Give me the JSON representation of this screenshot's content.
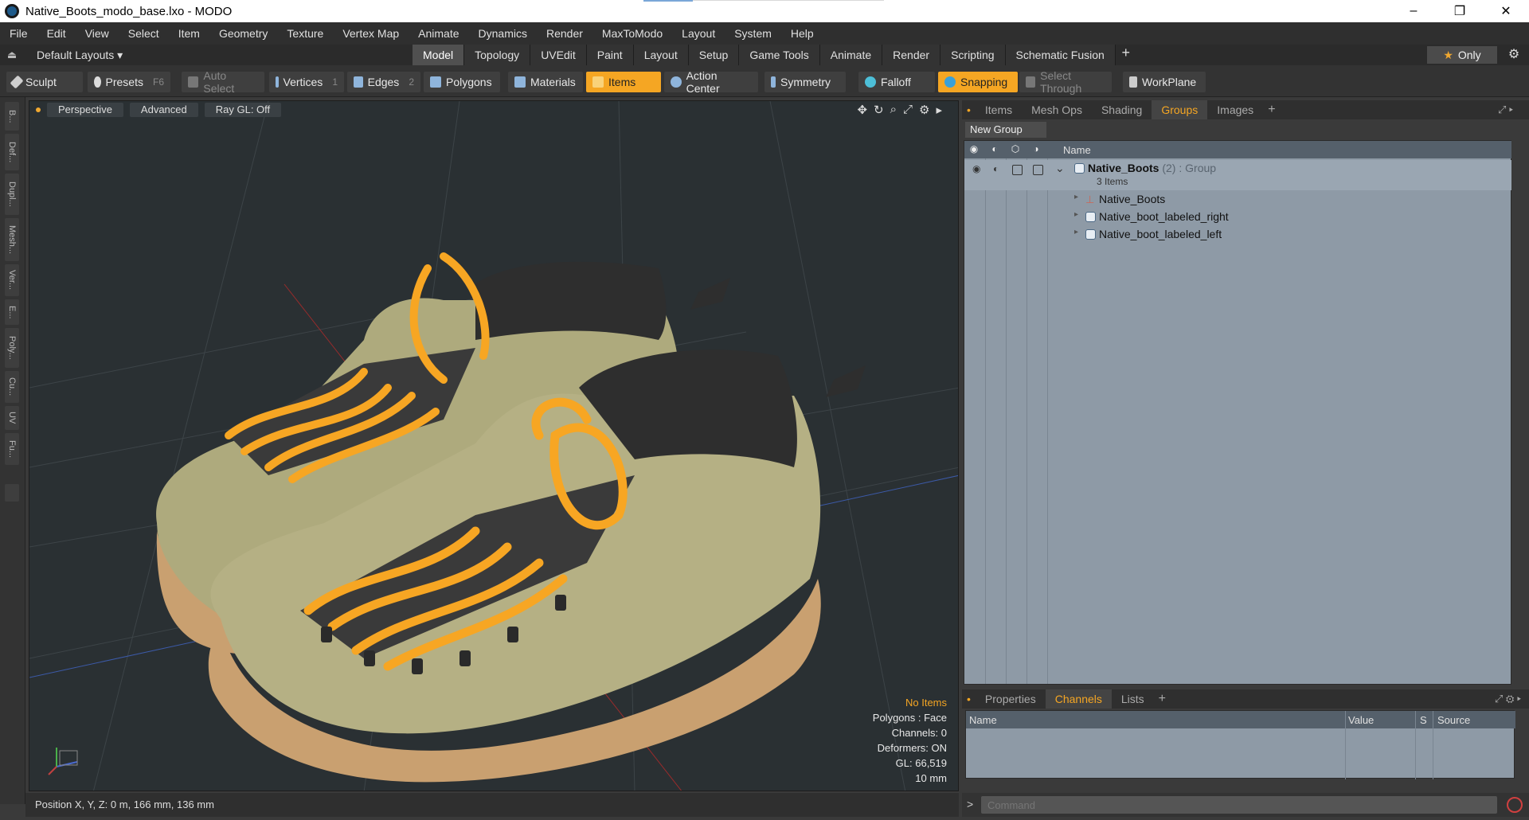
{
  "window": {
    "title": "Native_Boots_modo_base.lxo - MODO",
    "minimize": "–",
    "maximize": "❐",
    "close": "✕"
  },
  "menu": [
    "File",
    "Edit",
    "View",
    "Select",
    "Item",
    "Geometry",
    "Texture",
    "Vertex Map",
    "Animate",
    "Dynamics",
    "Render",
    "MaxToModo",
    "Layout",
    "System",
    "Help"
  ],
  "layout_bar": {
    "layouts": "Default Layouts ▾",
    "tabs": [
      "Model",
      "Topology",
      "UVEdit",
      "Paint",
      "Layout",
      "Setup",
      "Game Tools",
      "Animate",
      "Render",
      "Scripting",
      "Schematic Fusion"
    ],
    "active_tab": "Model",
    "add_tab": "+",
    "only": "Only",
    "star": "★",
    "gear": "⚙"
  },
  "toolbar": {
    "sculpt": "Sculpt",
    "presets": "Presets",
    "presets_key": "F6",
    "auto_select": "Auto Select",
    "vertices": "Vertices",
    "vertices_num": "1",
    "edges": "Edges",
    "edges_num": "2",
    "polygons": "Polygons",
    "materials": "Materials",
    "items": "Items",
    "action_center": "Action Center",
    "symmetry": "Symmetry",
    "falloff": "Falloff",
    "snapping": "Snapping",
    "select_through": "Select Through",
    "workplane": "WorkPlane"
  },
  "left_strip": [
    "B...",
    "Def...",
    "Dupl...",
    "Mesh...",
    "Ver...",
    "E...",
    "Poly...",
    "Cu...",
    "UV",
    "Fu..."
  ],
  "viewport": {
    "tabs": [
      "Perspective",
      "Advanced",
      "Ray GL: Off"
    ],
    "stats": {
      "no_items": "No Items",
      "polygons": "Polygons : Face",
      "channels": "Channels: 0",
      "deformers": "Deformers: ON",
      "gl": "GL: 66,519",
      "scale": "10 mm"
    }
  },
  "right_panel": {
    "tabs": [
      "Items",
      "Mesh Ops",
      "Shading",
      "Groups",
      "Images"
    ],
    "active_tab": "Groups",
    "add_tab": "+",
    "new_group": "New Group",
    "column_name": "Name",
    "group": {
      "name": "Native_Boots",
      "count": "(2)",
      "type": ": Group",
      "items_label": "3 Items"
    },
    "children": [
      {
        "name": "Native_Boots",
        "icon": "locator-icon"
      },
      {
        "name": "Native_boot_labeled_right",
        "icon": "mesh-icon"
      },
      {
        "name": "Native_boot_labeled_left",
        "icon": "mesh-icon"
      }
    ]
  },
  "channels_panel": {
    "tabs": [
      "Properties",
      "Channels",
      "Lists"
    ],
    "active_tab": "Channels",
    "add_tab": "+",
    "columns": {
      "name": "Name",
      "value": "Value",
      "s": "S",
      "source": "Source"
    }
  },
  "command": {
    "placeholder": "Command",
    "arrow": ">"
  },
  "status": {
    "position": "Position X, Y, Z:   0 m, 166 mm, 136 mm"
  },
  "colors": {
    "accent": "#f5a623",
    "boot_body": "#b5b084",
    "sole": "#c9a070",
    "lace": "#f7a623",
    "collar": "#2e2e2e"
  }
}
